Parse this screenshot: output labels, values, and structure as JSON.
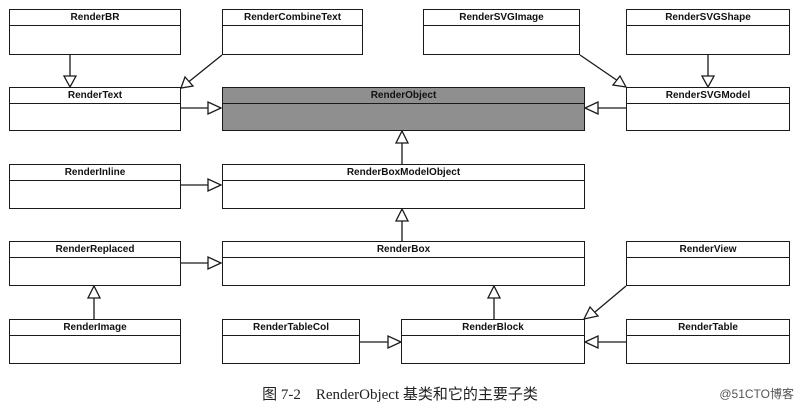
{
  "diagram": {
    "classes": {
      "renderBR": "RenderBR",
      "renderCombineText": "RenderCombineText",
      "renderSVGImage": "RenderSVGImage",
      "renderSVGShape": "RenderSVGShape",
      "renderText": "RenderText",
      "renderObject": "RenderObject",
      "renderSVGModel": "RenderSVGModel",
      "renderInline": "RenderInline",
      "renderBoxModelObject": "RenderBoxModelObject",
      "renderReplaced": "RenderReplaced",
      "renderBox": "RenderBox",
      "renderView": "RenderView",
      "renderImage": "RenderImage",
      "renderTableCol": "RenderTableCol",
      "renderBlock": "RenderBlock",
      "renderTable": "RenderTable"
    },
    "root_color": "#8f8f8f"
  },
  "caption": "图 7-2　RenderObject 基类和它的主要子类",
  "watermark": "@51CTO博客"
}
